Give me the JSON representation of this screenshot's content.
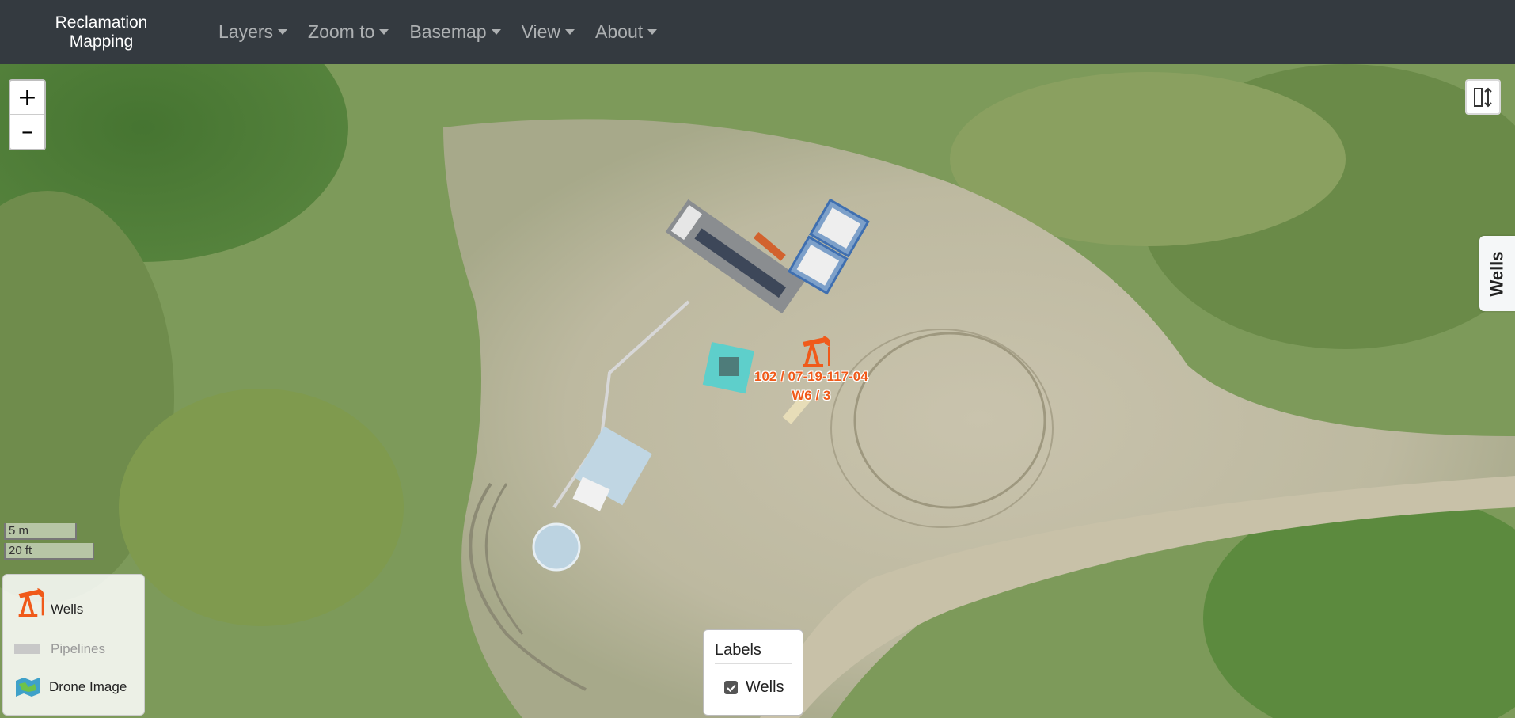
{
  "navbar": {
    "brand_line1": "Reclamation",
    "brand_line2": "Mapping",
    "items": [
      {
        "label": "Layers"
      },
      {
        "label": "Zoom to"
      },
      {
        "label": "Basemap"
      },
      {
        "label": "View"
      },
      {
        "label": "About"
      }
    ]
  },
  "map": {
    "zoom_in": "+",
    "zoom_out": "–",
    "wells_tab": "Wells",
    "scale_metric": "5 m",
    "scale_imperial": "20 ft",
    "well_label_line1": "102 / 07-19-117-04",
    "well_label_line2": "W6 / 3"
  },
  "legend": {
    "items": [
      {
        "label": "Wells",
        "icon": "pumpjack-icon"
      },
      {
        "label": "Pipelines",
        "icon": "pipeline-line-icon"
      },
      {
        "label": "Drone Image",
        "icon": "drone-image-icon"
      }
    ]
  },
  "labels_panel": {
    "title": "Labels",
    "option": "Wells",
    "checked": true
  },
  "colors": {
    "navbar": "#343a40",
    "well_orange": "#f05a1a"
  }
}
